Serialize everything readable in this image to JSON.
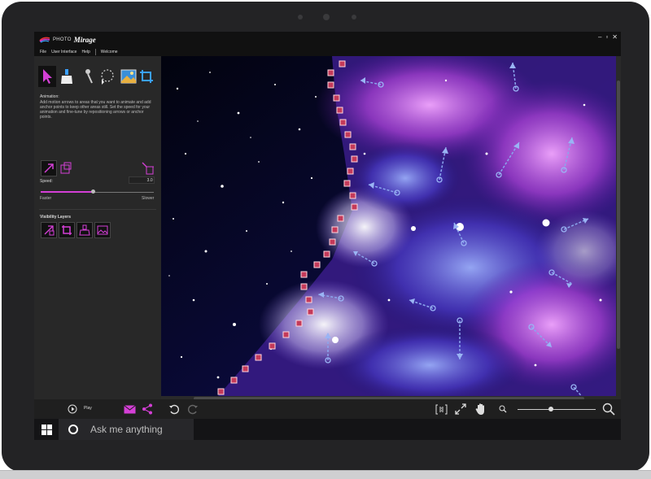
{
  "app": {
    "brand_prefix": "PHOTO",
    "brand_name": "Mirage"
  },
  "window_controls": [
    "–",
    "▫",
    "✕"
  ],
  "menu": {
    "items": [
      "File",
      "User Interface",
      "Help",
      "Welcome"
    ]
  },
  "tools": [
    {
      "name": "animate-tool",
      "active": true
    },
    {
      "name": "mask-tool",
      "active": false
    },
    {
      "name": "brush-tool",
      "active": false
    },
    {
      "name": "lasso-tool",
      "active": false
    },
    {
      "name": "image-tool",
      "active": false
    },
    {
      "name": "crop-tool",
      "active": false
    }
  ],
  "animation": {
    "title": "Animation:",
    "description": "Add motion arrows to areas that you want to animate and add anchor points to keep other areas still. Set the speed for your animation and fine-tune by repositioning arrows or anchor points."
  },
  "speed": {
    "label": "Speed:",
    "value": "3.0",
    "fraction": 0.46,
    "faster_label": "Faster",
    "slower_label": "Slower"
  },
  "visibility_layers": {
    "title": "Visibility Layers"
  },
  "bottom": {
    "play_label": "Play"
  },
  "zoom": {
    "fraction": 0.43
  },
  "taskbar": {
    "search_placeholder": "Ask me anything"
  },
  "colors": {
    "accent": "#d43fd6",
    "arrow": "#7aa0e6",
    "anchor": "#c43a5a"
  }
}
